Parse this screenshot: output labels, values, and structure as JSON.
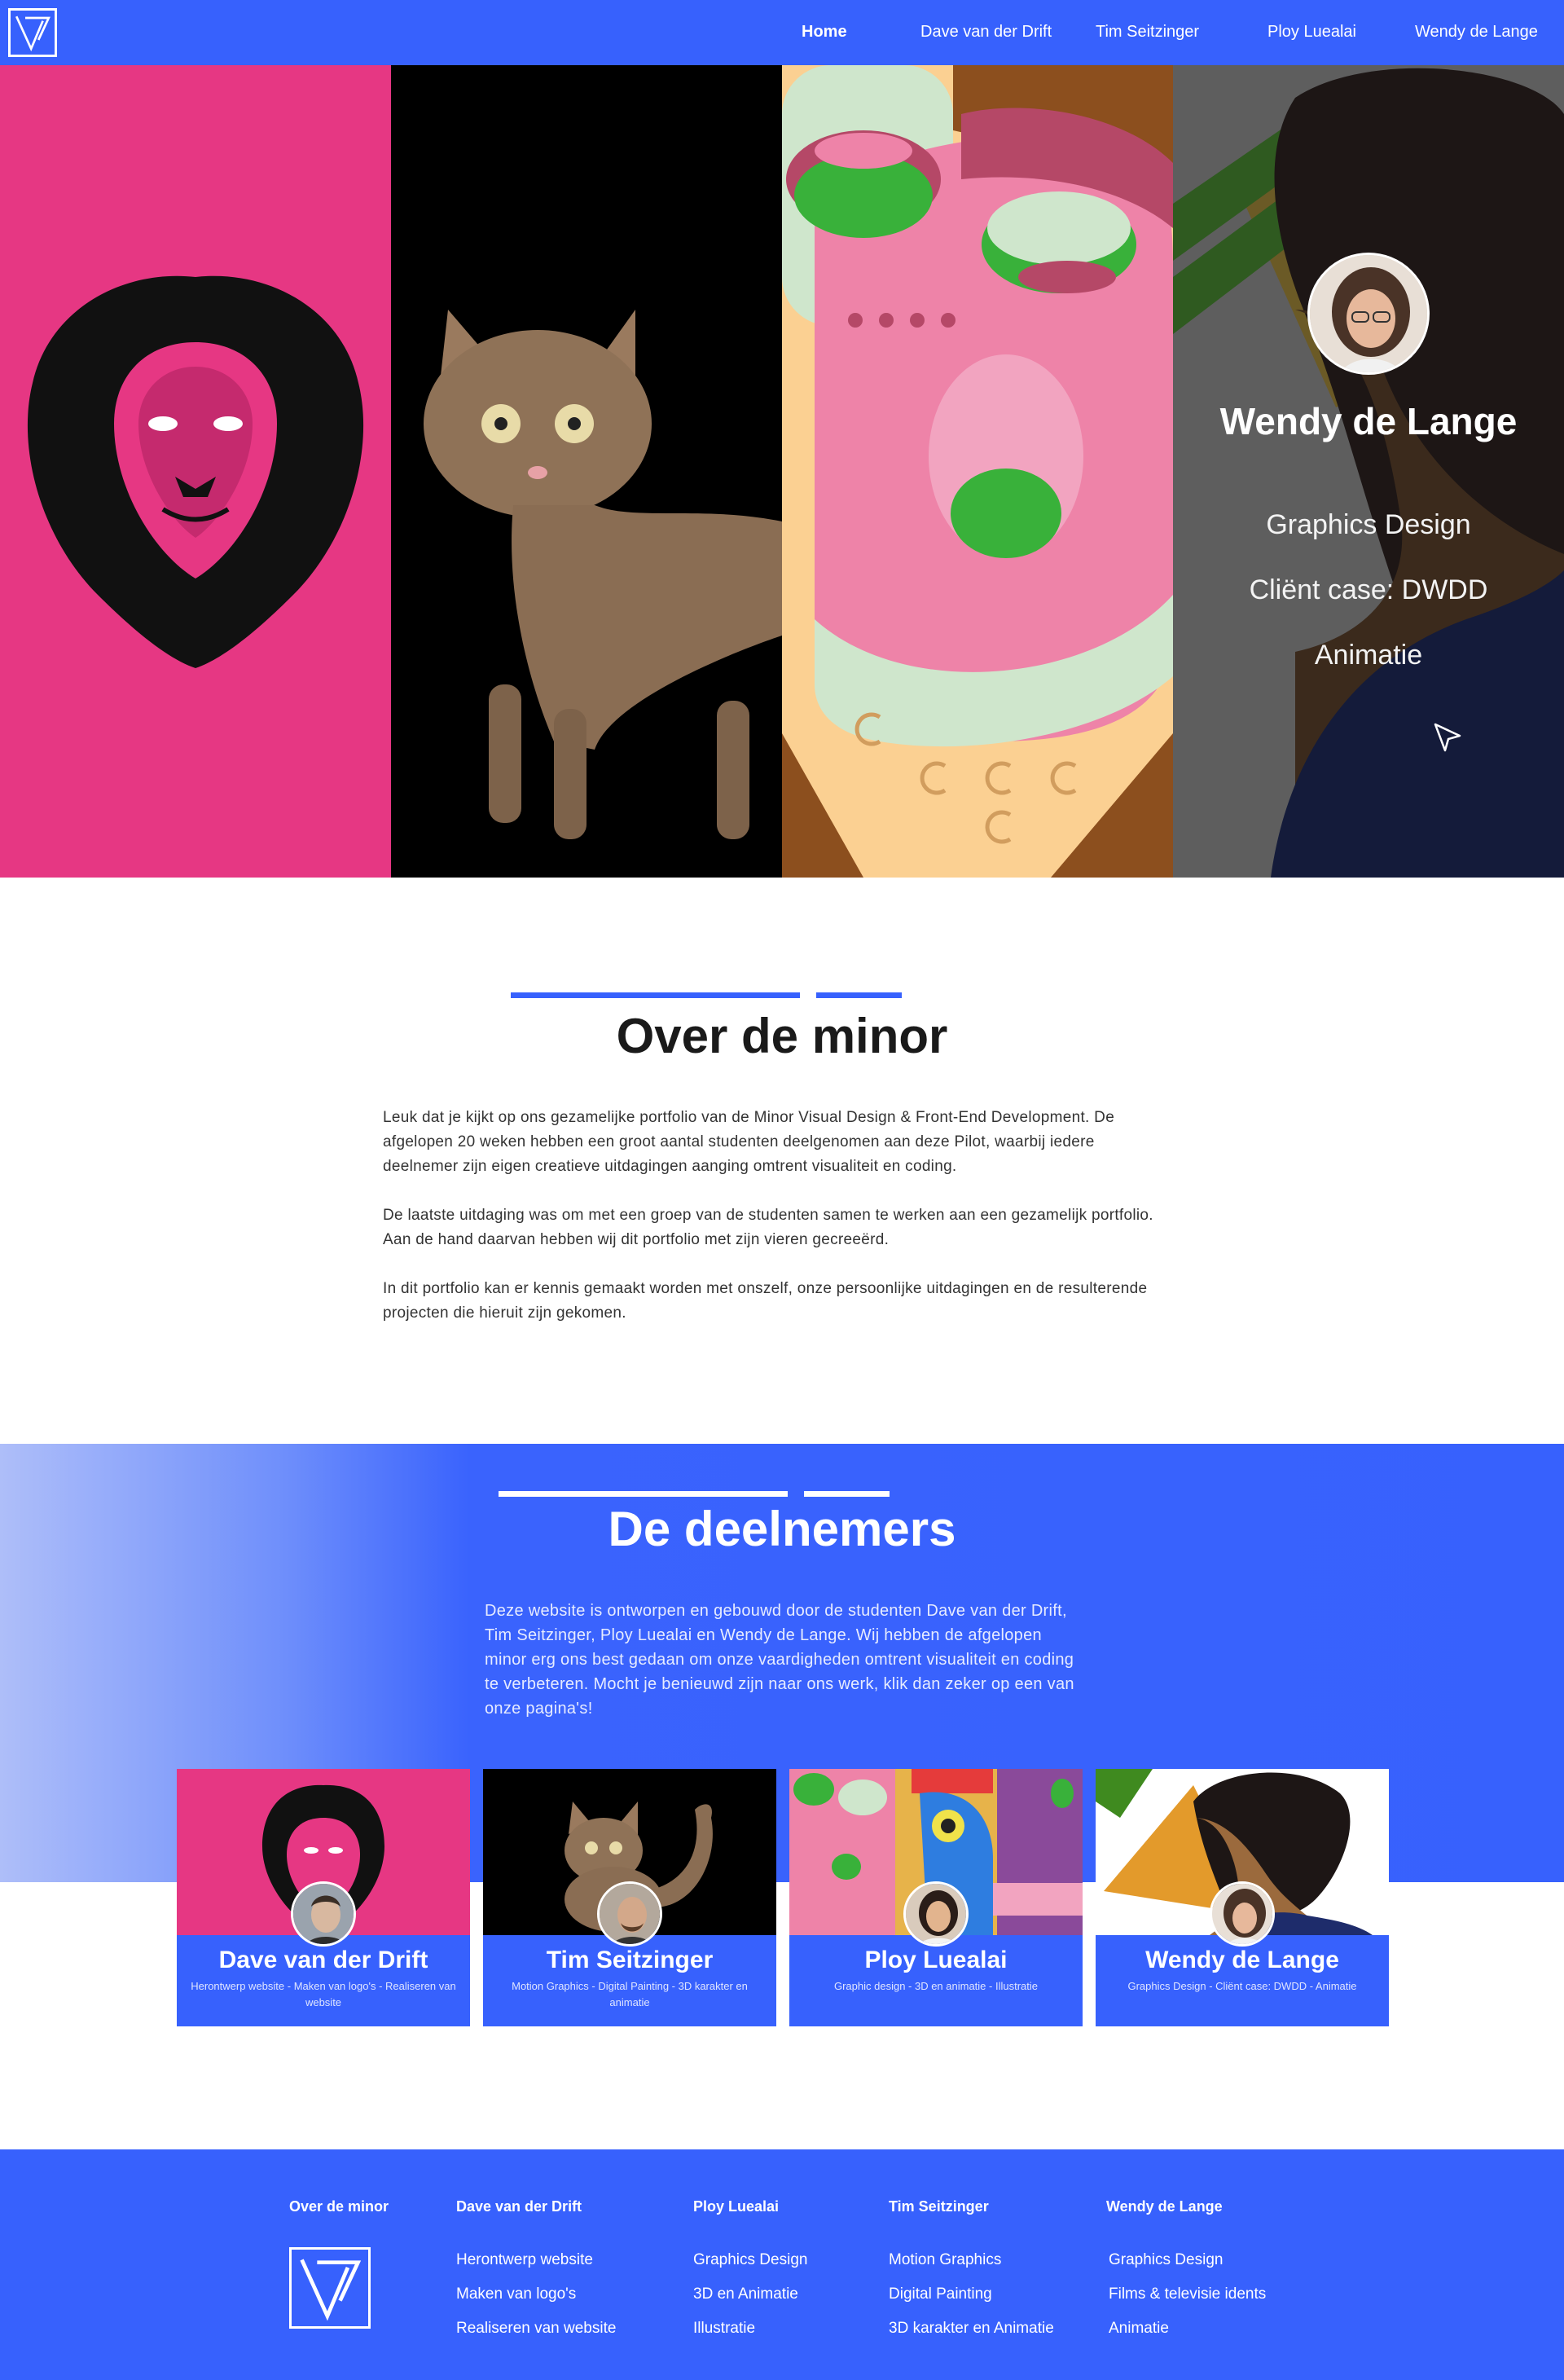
{
  "nav": {
    "items": [
      {
        "label": "Home"
      },
      {
        "label": "Dave van der Drift"
      },
      {
        "label": "Tim Seitzinger"
      },
      {
        "label": "Ploy Luealai"
      },
      {
        "label": "Wendy de Lange"
      }
    ]
  },
  "hero": {
    "name": "Wendy de Lange",
    "lines": [
      "Graphics Design",
      "Cliënt case: DWDD",
      "Animatie"
    ]
  },
  "about": {
    "title": "Over de minor",
    "paragraphs": [
      "Leuk dat je kijkt op ons gezamelijke portfolio van de Minor Visual Design & Front-End Development. De afgelopen 20 weken hebben een groot aantal studenten deelgenomen aan deze Pilot, waarbij iedere deelnemer zijn eigen creatieve uitdagingen aanging omtrent visualiteit en coding.",
      "De laatste uitdaging was om met een groep van de studenten samen te werken aan een gezamelijk portfolio. Aan de hand daarvan hebben wij dit portfolio met zijn vieren gecreeërd.",
      "In dit portfolio kan er kennis gemaakt worden met onszelf, onze persoonlijke uitdagingen en de resulterende projecten die hieruit zijn gekomen."
    ]
  },
  "participants": {
    "title": "De deelnemers",
    "text": "Deze website is ontworpen en gebouwd door de studenten Dave van der Drift, Tim Seitzinger, Ploy Luealai en Wendy de Lange. Wij hebben de afgelopen minor erg ons best gedaan om onze vaardigheden omtrent visualiteit en coding te verbeteren. Mocht je benieuwd zijn naar ons werk, klik dan zeker op een van onze pagina's!",
    "cards": [
      {
        "name": "Dave van der Drift",
        "sub": "Herontwerp website - Maken van logo's - Realiseren van website"
      },
      {
        "name": "Tim Seitzinger",
        "sub": "Motion Graphics - Digital Painting - 3D karakter en animatie"
      },
      {
        "name": "Ploy Luealai",
        "sub": "Graphic design - 3D en animatie - Illustratie"
      },
      {
        "name": "Wendy de Lange",
        "sub": "Graphics Design - Cliënt case: DWDD - Animatie"
      }
    ]
  },
  "footer": {
    "columns": [
      {
        "heading": "Over de minor",
        "links": []
      },
      {
        "heading": "Dave van der Drift",
        "links": [
          "Herontwerp website",
          "Maken van logo's",
          "Realiseren van website"
        ]
      },
      {
        "heading": "Ploy Luealai",
        "links": [
          "Graphics Design",
          "3D en Animatie",
          "Illustratie"
        ]
      },
      {
        "heading": "Tim Seitzinger",
        "links": [
          "Motion Graphics",
          "Digital Painting",
          "3D karakter en Animatie"
        ]
      },
      {
        "heading": "Wendy de Lange",
        "links": [
          "Graphics Design",
          "Films & televisie idents",
          "Animatie"
        ]
      }
    ]
  },
  "colors": {
    "brand_blue": "#3761fd",
    "lion_pink": "#e63783",
    "title_dark": "#1a1a1a"
  }
}
